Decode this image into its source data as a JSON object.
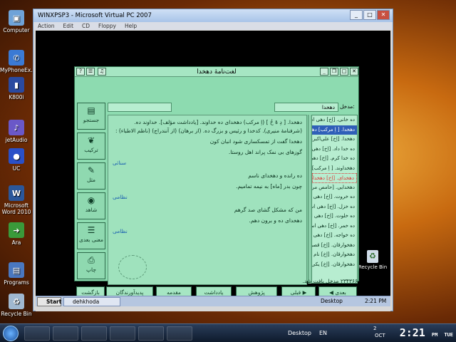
{
  "host": {
    "icons": [
      {
        "label": "Computer",
        "icon": "computer-icon",
        "color": "#6fa3d8",
        "glyph": "▣"
      },
      {
        "label": "MyPhoneEx...",
        "icon": "phone-icon",
        "color": "#3b7ad4",
        "glyph": "✆"
      },
      {
        "label": "K800i",
        "icon": "mobile-icon",
        "color": "#2a4aa0",
        "glyph": "▮"
      },
      {
        "label": "jetAudio",
        "icon": "audio-icon",
        "color": "#6a58c8",
        "glyph": "♪"
      },
      {
        "label": "UC",
        "icon": "uc-icon",
        "color": "#2a50c8",
        "glyph": "●"
      },
      {
        "label": "Microsoft Word 2010",
        "icon": "word-icon",
        "color": "#2b579a",
        "glyph": "W"
      },
      {
        "label": "Ara",
        "icon": "arrow-icon",
        "color": "#3a9a3a",
        "glyph": "➜"
      },
      {
        "label": "Programs",
        "icon": "programs-icon",
        "color": "#4a78c0",
        "glyph": "▤"
      },
      {
        "label": "Recycle Bin",
        "icon": "recycle-bin-icon",
        "color": "#a0b8d0",
        "glyph": "♻"
      }
    ],
    "taskbar": {
      "desktop_label": "Desktop",
      "lang": "EN",
      "time": "2:21",
      "ampm": "PM",
      "day": "TUE",
      "month": "OCT",
      "date": "2"
    }
  },
  "vpc": {
    "title": "WINXPSP3 - Microsoft Virtual PC 2007",
    "menu": [
      "Action",
      "Edit",
      "CD",
      "Floppy",
      "Help"
    ],
    "guest_recycle_bin": "Recycle Bin",
    "guest_taskbar": {
      "start": "Start",
      "task": "dehkhoda",
      "desktop": "Desktop",
      "time": "2:21 PM"
    }
  },
  "app": {
    "title": "لغت‌نامهٔ دهخدا",
    "search_label": "مدخل:",
    "search_value": "دهخدا",
    "side_buttons": [
      {
        "label": "جستجو",
        "icon": "book-icon",
        "glyph": "▤"
      },
      {
        "label": "ترکیب",
        "icon": "compose-icon",
        "glyph": "❦"
      },
      {
        "label": "مثل",
        "icon": "proverb-icon",
        "glyph": "✎"
      },
      {
        "label": "شاهد",
        "icon": "eye-icon",
        "glyph": "◉"
      },
      {
        "label": "معنی بعدی",
        "icon": "next-meaning-icon",
        "glyph": "☰"
      },
      {
        "label": "چاپ",
        "icon": "printer-icon",
        "glyph": "⎙"
      }
    ],
    "bottom_buttons": [
      {
        "label": "بعدی",
        "icon": "right-arrow-icon"
      },
      {
        "label": "قبلی",
        "icon": "left-arrow-icon"
      },
      {
        "label": "پژوهش"
      },
      {
        "label": "یادداشت"
      },
      {
        "label": "مقدمه"
      },
      {
        "label": "پدیدآورندگان"
      },
      {
        "label": "بازگشت"
      }
    ],
    "content": {
      "lines": [
        "دهخدا. [ دِ هْ خُ ] (اِ مرکب) دهخدای ده خداوند. [یادداشت مؤلف]. خداوند ده. (شرفنامهٔ منیری). کدخدا و رئیس و بزرگ ده. (از برهان) (از آنندراج) (ناظم الاطباء) :",
        "دهخدا گفت از تمسکساری شود انبان کون",
        "گوزهای بی نمک پراند اهل روستا.",
        "ده رانده و دهخدای ناسم",
        "چون بدر [ماه] به نیمه تمامیم.",
        "من که مشکل گشای صد گرهم",
        "دهخدای ده و برون دهم."
      ],
      "sources": [
        "سنائی",
        "نظامی",
        "نظامی"
      ]
    },
    "word_list": [
      "ده خانی. [اِخ] دهی است",
      "دهخدا. [ اِ مرکب] دهخدای ده",
      "دهخدا. [اِخ] علی‌اکبرین خانبابا",
      "ده خدا داد. [اِخ] دهی است",
      "ده خدا کرم. [اِخ] دهی است",
      "دهخداوند. [ اِ مرکب] ...",
      "دهخدای. [اِخ] دهخدا",
      "دهخدایی. [حامص مرکب] ...",
      "ده خروت. [اِخ] دهی است",
      "ده خزل. [اِخ] دهی است",
      "ده خلوت. [اِخ] دهی است",
      "ده خمر. [اِخ] دهی است",
      "ده خواجه. [اِخ] دهی است",
      "دهخوارقان. [اِخ] قصبهٔ ...",
      "دهخوارقان. [اِخ] نام یکی",
      "دهخوارقان. [اِخ] یکی از"
    ],
    "selected_index": 1,
    "focused_index": 6,
    "status": "۲۳۴۳۶۶ مدخل یافت شد."
  }
}
